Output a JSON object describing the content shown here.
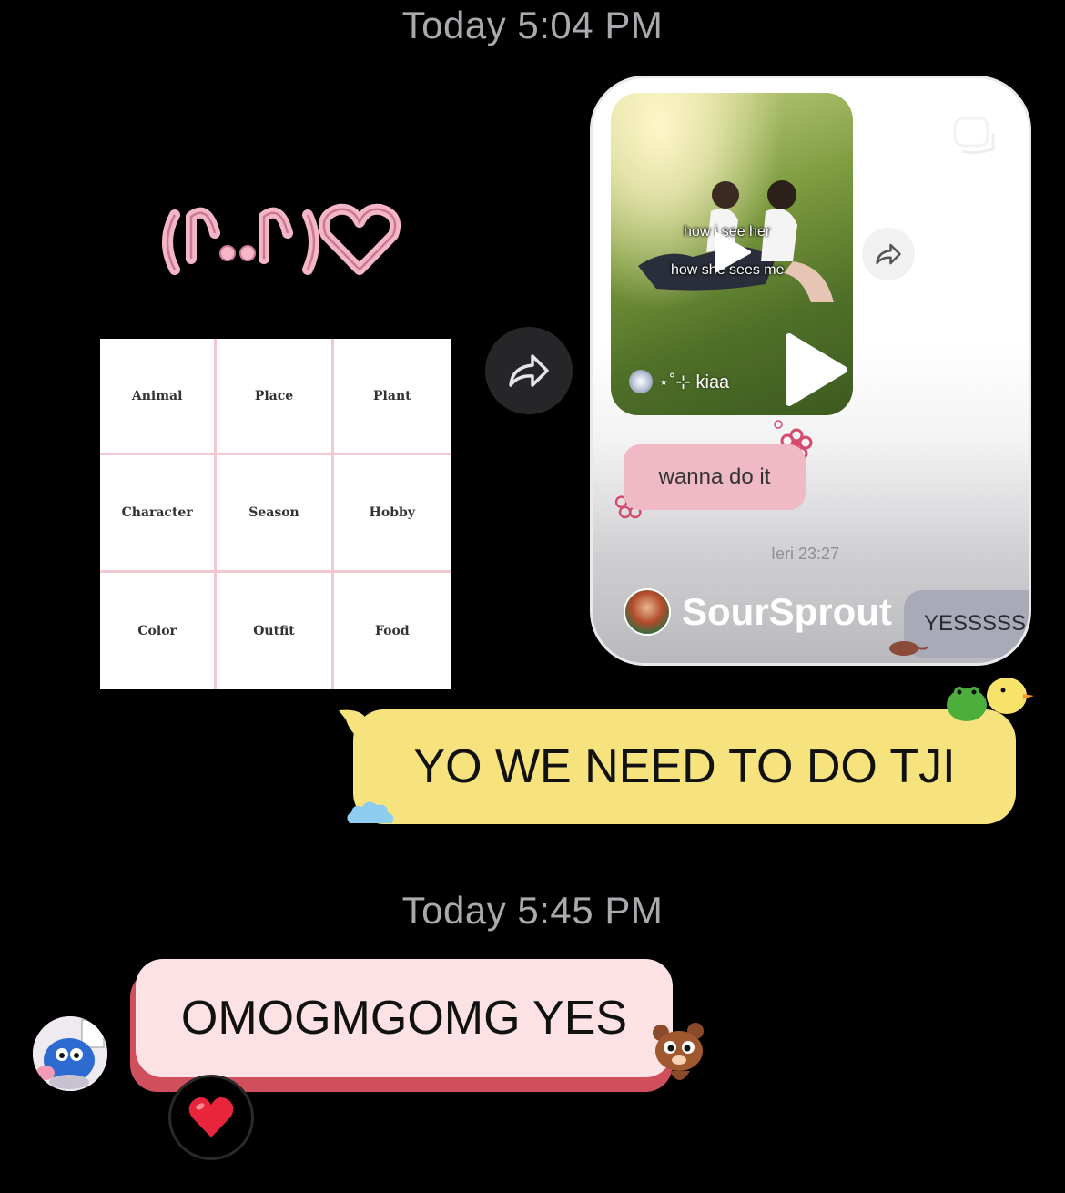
{
  "timestamps": [
    "Today 5:04 PM",
    "Today 5:45 PM"
  ],
  "grid": {
    "cells": [
      "Animal",
      "Place",
      "Plant",
      "Character",
      "Season",
      "Hobby",
      "Color",
      "Outfit",
      "Food"
    ]
  },
  "shared_reel": {
    "overlay_line1": "how i see her",
    "overlay_line2": "how she sees me",
    "author": "⋆˚⊹ kiaa",
    "bubble_text": "wanna do it",
    "bubble_time": "Ieri 23:27",
    "sender": "SourSprout",
    "reply_text": "YESSSSS"
  },
  "messages": {
    "outgoing": "YO WE NEED TO DO TJI",
    "incoming": "OMOGMGOMG YES"
  },
  "reaction": "❤️",
  "colors": {
    "background": "#000000",
    "outgoing_bubble": "#f6e37e",
    "incoming_bubble": "#fde2e5",
    "incoming_shadow": "#d04f5d",
    "kaomoji_pink": "#f5b6c8"
  }
}
